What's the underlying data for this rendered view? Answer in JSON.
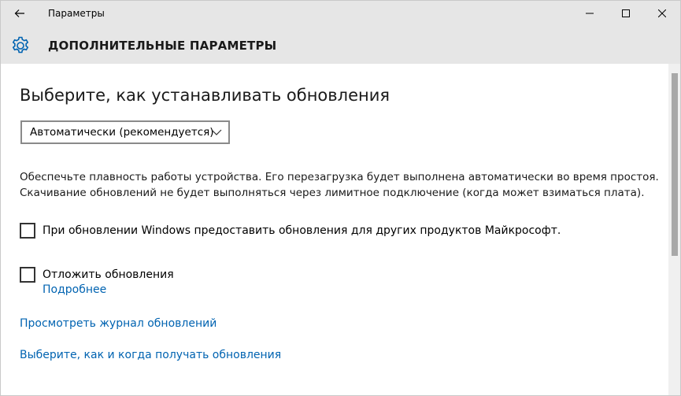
{
  "window": {
    "title": "Параметры"
  },
  "header": {
    "title": "ДОПОЛНИТЕЛЬНЫЕ ПАРАМЕТРЫ",
    "icon": "gear-icon"
  },
  "main": {
    "heading": "Выберите, как устанавливать обновления",
    "install_mode": {
      "selected": "Автоматически (рекомендуется)"
    },
    "description": {
      "line1": "Обеспечьте плавность работы устройства. Его перезагрузка будет выполнена автоматически во время простоя.",
      "line2": "Скачивание обновлений не будет выполняться через лимитное подключение (когда может взиматься плата)."
    },
    "other_products_checkbox": {
      "label": "При обновлении Windows предоставить обновления для других продуктов Майкрософт.",
      "checked": false
    },
    "defer_checkbox": {
      "label": "Отложить обновления",
      "checked": false
    },
    "more_info_link": "Подробнее",
    "history_link": "Просмотреть журнал обновлений",
    "delivery_link": "Выберите, как и когда получать обновления"
  },
  "colors": {
    "titlebar_bg": "#e6e6e6",
    "accent_link": "#0063b1",
    "gear_blue": "#0063b1"
  }
}
